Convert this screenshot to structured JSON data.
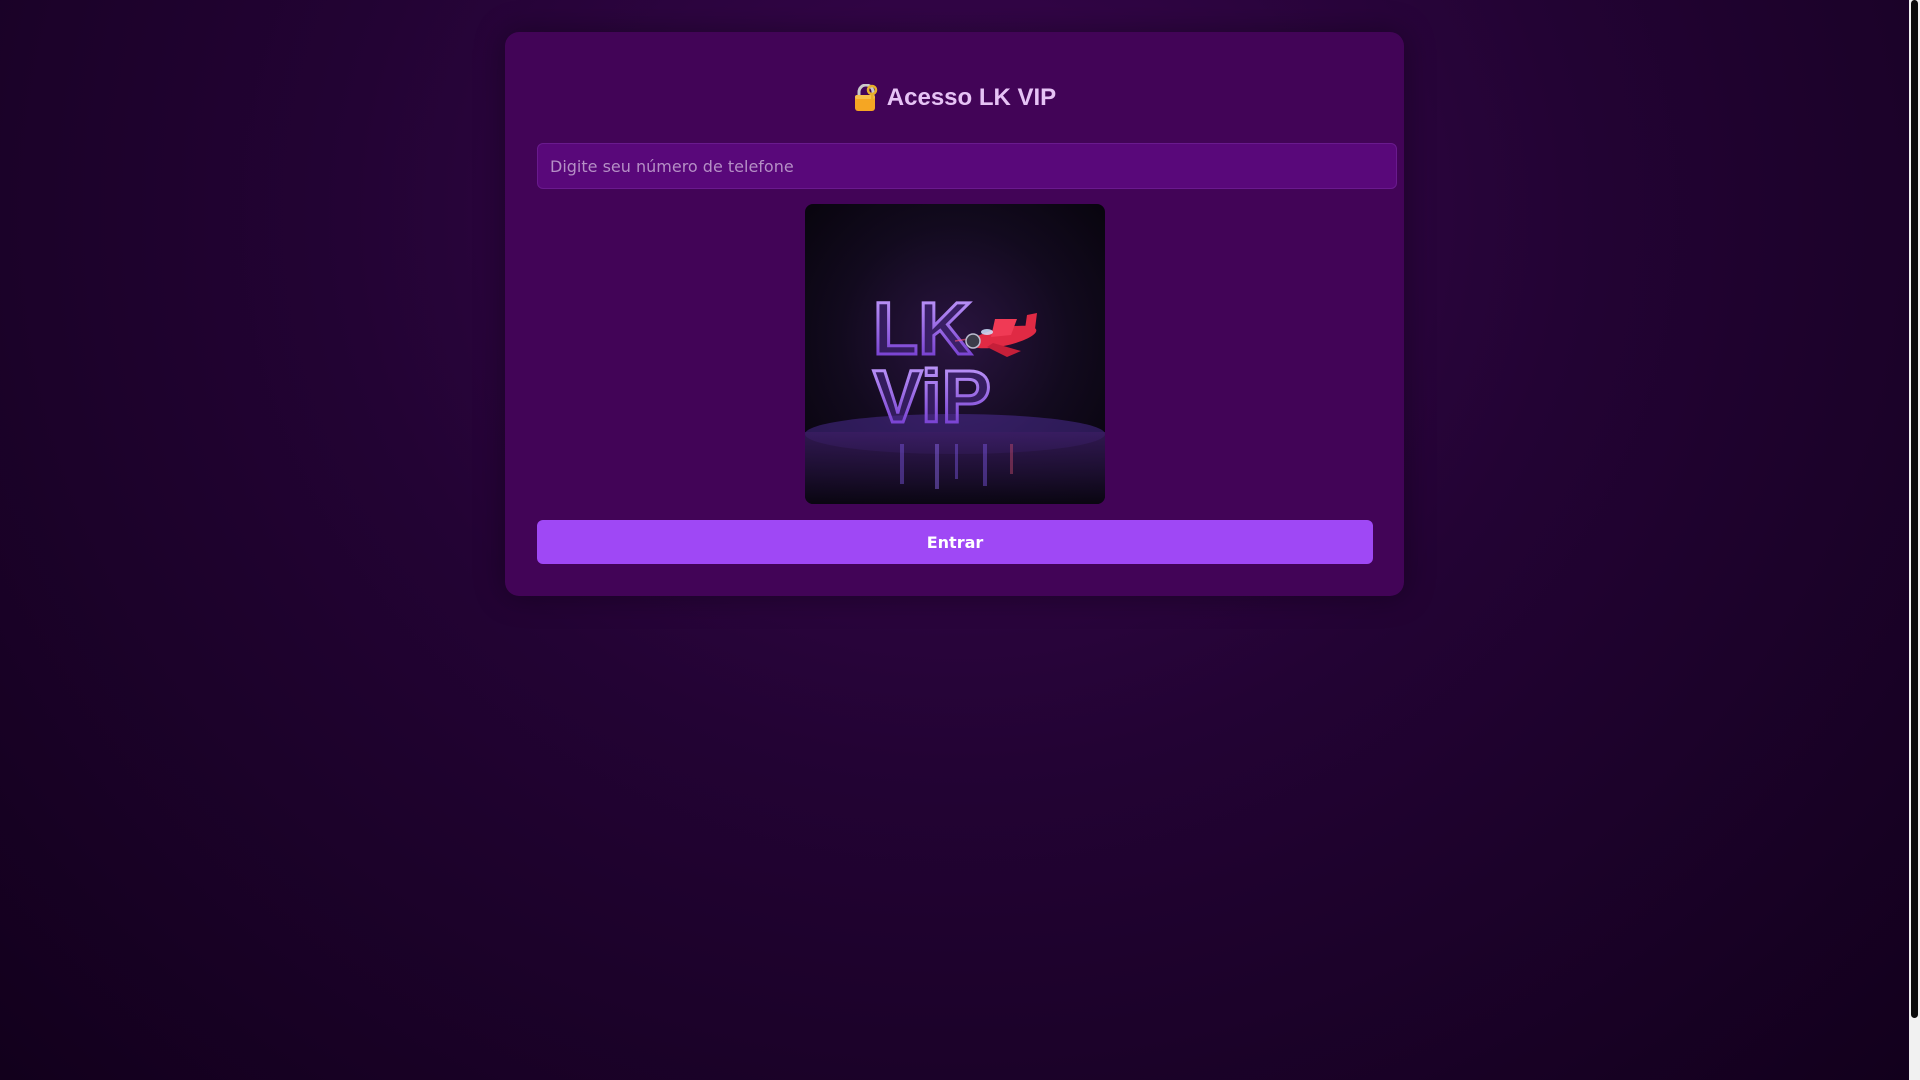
{
  "login": {
    "title": "Acesso LK VIP",
    "phone_placeholder": "Digite seu número de telefone",
    "phone_value": "",
    "logo_text_line1": "LK",
    "logo_text_line2": "ViP",
    "enter_label": "Entrar"
  },
  "icons": {
    "title_icon": "lock-with-key-icon"
  },
  "colors": {
    "card_background": "#420457",
    "input_background": "#59087a",
    "button_background": "#9f48f5",
    "title_color": "#e6c3f5"
  }
}
